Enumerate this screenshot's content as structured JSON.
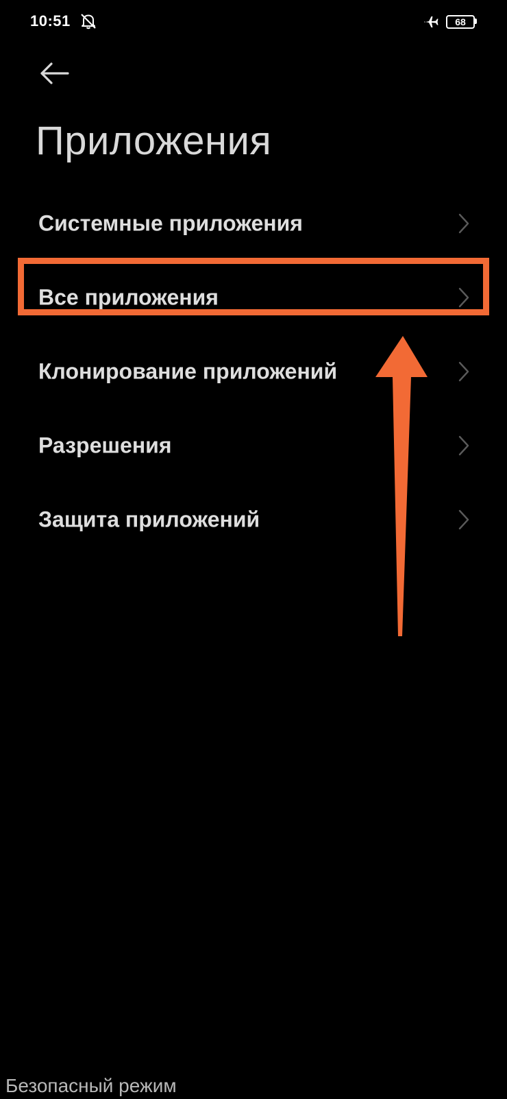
{
  "status_bar": {
    "time": "10:51",
    "icons": [
      "bell-off-icon",
      "airplane-icon"
    ],
    "battery_level": "68"
  },
  "header": {
    "back_icon": "arrow-left-icon",
    "title": "Приложения"
  },
  "menu": {
    "items": [
      {
        "label": "Системные приложения",
        "icon": "chevron-right-icon"
      },
      {
        "label": "Все приложения",
        "icon": "chevron-right-icon",
        "highlighted": true
      },
      {
        "label": "Клонирование приложений",
        "icon": "chevron-right-icon"
      },
      {
        "label": "Разрешения",
        "icon": "chevron-right-icon"
      },
      {
        "label": "Защита приложений",
        "icon": "chevron-right-icon"
      }
    ]
  },
  "annotation": {
    "color": "#f26a35",
    "type": "highlight-box-with-arrow"
  },
  "footer": {
    "safe_mode": "Безопасный режим"
  },
  "colors": {
    "background": "#000000",
    "text": "#dedede",
    "accent": "#f26a35"
  }
}
